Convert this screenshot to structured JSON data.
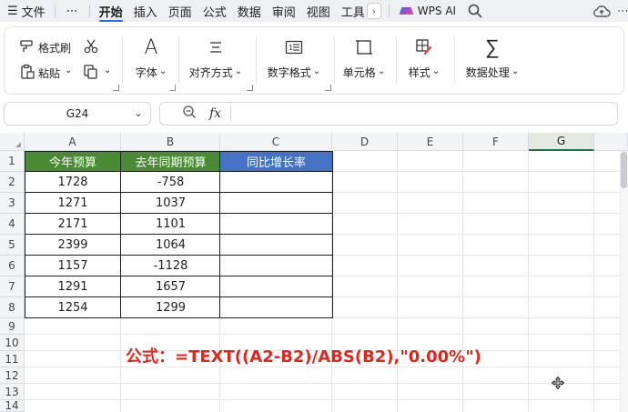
{
  "menubar": {
    "items": [
      {
        "label": "文件",
        "icon": "hamburger-icon"
      },
      {
        "label": "⋯"
      },
      {
        "label": "开始",
        "active": true
      },
      {
        "label": "插入"
      },
      {
        "label": "页面"
      },
      {
        "label": "公式"
      },
      {
        "label": "数据"
      },
      {
        "label": "审阅"
      },
      {
        "label": "视图"
      },
      {
        "label": "工具"
      }
    ],
    "wps_ai": "WPS AI"
  },
  "ribbon": {
    "format_painter": "格式刷",
    "paste": "粘贴",
    "font": "字体",
    "align": "对齐方式",
    "number_format": "数字格式",
    "cells": "单元格",
    "styles": "样式",
    "data_processing": "数据处理"
  },
  "formula_bar": {
    "name_box": "G24",
    "fx": "fx",
    "formula": ""
  },
  "columns": [
    "A",
    "B",
    "C",
    "D",
    "E",
    "F",
    "G"
  ],
  "selected_column": "G",
  "rows": [
    "1",
    "2",
    "3",
    "4",
    "5",
    "6",
    "7",
    "8",
    "9",
    "10",
    "11",
    "12",
    "13",
    "14"
  ],
  "table": {
    "headers": [
      "今年预算",
      "去年同期预算",
      "同比增长率"
    ],
    "header_colors": [
      "#4a8a34",
      "#4a8a34",
      "#4472c4"
    ],
    "data": [
      [
        "1728",
        "-758",
        ""
      ],
      [
        "1271",
        "1037",
        ""
      ],
      [
        "2171",
        "1101",
        ""
      ],
      [
        "2399",
        "1064",
        ""
      ],
      [
        "1157",
        "-1128",
        ""
      ],
      [
        "1291",
        "1657",
        ""
      ],
      [
        "1254",
        "1299",
        ""
      ]
    ]
  },
  "annotation": {
    "text": "公式：=TEXT((A2-B2)/ABS(B2),\"0.00%\")",
    "color": "#e3261d"
  }
}
